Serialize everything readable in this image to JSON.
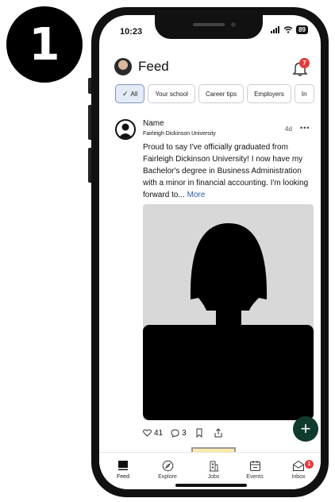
{
  "step_number": "1",
  "status_bar": {
    "time": "10:23",
    "battery": "89"
  },
  "header": {
    "title": "Feed",
    "notification_count": "7"
  },
  "filter_chips": [
    {
      "label": "All",
      "active": true
    },
    {
      "label": "Your school",
      "active": false
    },
    {
      "label": "Career tips",
      "active": false
    },
    {
      "label": "Employers",
      "active": false
    },
    {
      "label": "In",
      "active": false
    }
  ],
  "post": {
    "author_name": "Name",
    "school": "Fairleigh Dickinson University",
    "time_ago": "4d",
    "more_menu": "•••",
    "body": "Proud to say I've officially graduated from Fairleigh Dickinson University! I now have my Bachelor's degree in Business Administration with a minor in financial accounting. I'm looking forward to...",
    "more_link": "More",
    "like_count": "41",
    "comment_count": "3"
  },
  "fab_label": "+",
  "nav": {
    "items": [
      {
        "label": "Feed",
        "icon": "feed-icon",
        "selected": true
      },
      {
        "label": "Explore",
        "icon": "compass-icon",
        "selected": false
      },
      {
        "label": "Jobs",
        "icon": "building-icon",
        "selected": false,
        "highlighted": true
      },
      {
        "label": "Events",
        "icon": "calendar-icon",
        "selected": false
      },
      {
        "label": "Inbox",
        "icon": "inbox-icon",
        "selected": false
      }
    ],
    "inbox_badge": "1"
  },
  "colors": {
    "accent_blue": "#2a5db0",
    "fab_green": "#0e3b2e",
    "badge_red": "#e63a3a",
    "highlight_yellow": "#fbeaa8"
  }
}
